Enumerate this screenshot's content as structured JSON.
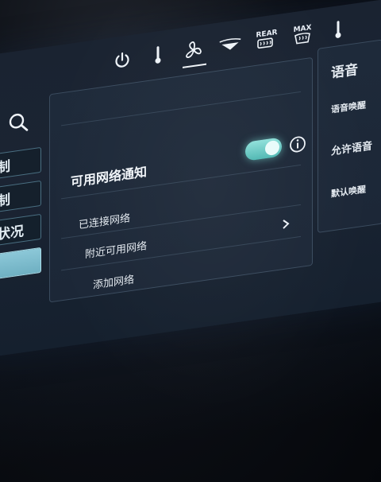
{
  "topbar": {
    "icons": [
      "power-icon",
      "temperature-icon",
      "fan-icon",
      "windshield-airflow-icon",
      "rear-defrost-icon",
      "max-defrost-icon",
      "temperature-icon"
    ],
    "rear_label": "REAR",
    "max_label": "MAX"
  },
  "left_menu": {
    "items": [
      {
        "label": "控制"
      },
      {
        "label": "控制"
      },
      {
        "label": "辆状况"
      },
      {
        "label": ""
      }
    ]
  },
  "card": {
    "notification_title": "可用网络通知",
    "toggle_on": true,
    "rows": [
      {
        "label": "已连接网络"
      },
      {
        "label": "附近可用网络"
      },
      {
        "label": "添加网络"
      }
    ]
  },
  "right_panel": {
    "title": "语音",
    "items": [
      {
        "label": "语音唤醒"
      },
      {
        "label": "允许语音"
      },
      {
        "label": "默认唤醒"
      }
    ]
  },
  "colors": {
    "accent_toggle": "#6fd0ca",
    "active_menu": "#8cc8d8",
    "panel_bg": "#1e2a3a"
  }
}
